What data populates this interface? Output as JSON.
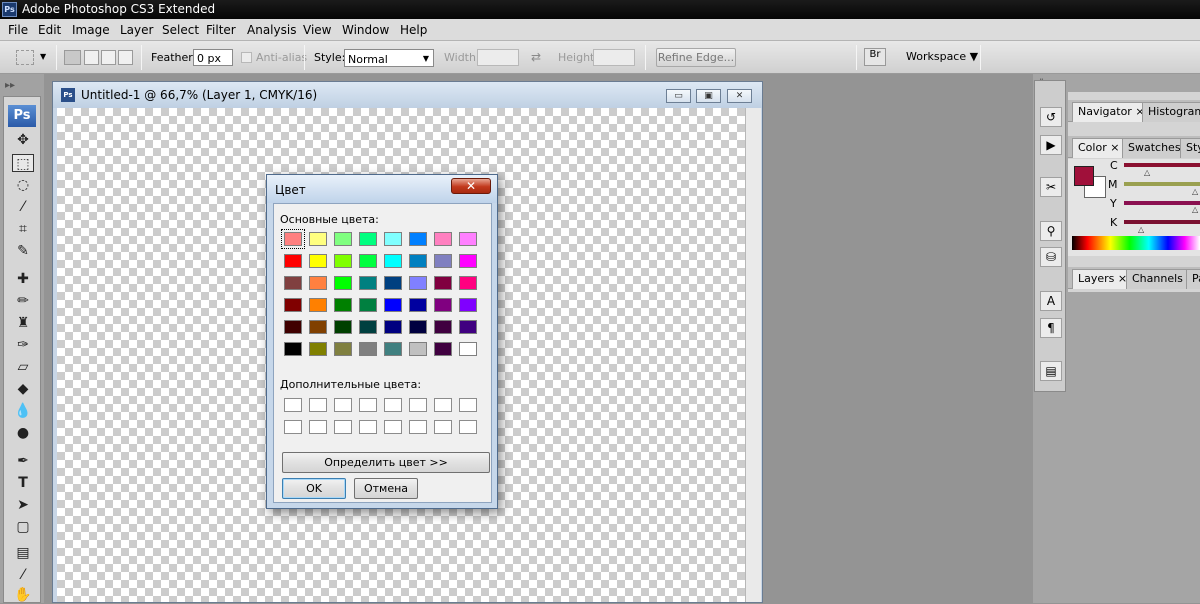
{
  "app": {
    "title": "Adobe Photoshop CS3 Extended",
    "ps_badge": "Ps"
  },
  "menu": [
    "File",
    "Edit",
    "Image",
    "Layer",
    "Select",
    "Filter",
    "Analysis",
    "View",
    "Window",
    "Help"
  ],
  "options": {
    "feather_label": "Feather:",
    "feather_value": "0 px",
    "antialias_label": "Anti-alias",
    "style_label": "Style:",
    "style_value": "Normal",
    "width_label": "Width:",
    "height_label": "Height:",
    "refine_edge": "Refine Edge...",
    "workspace": "Workspace ▼"
  },
  "toolbox": {
    "logo": "Ps"
  },
  "document": {
    "title": "Untitled-1 @ 66,7% (Layer 1, CMYK/16)",
    "icon": "Ps"
  },
  "dialog": {
    "title": "Цвет",
    "basic_label": "Основные цвета:",
    "custom_label": "Дополнительные цвета:",
    "define_button": "Определить цвет >>",
    "ok_button": "OK",
    "cancel_button": "Отмена",
    "close_icon": "✕",
    "basic_colors": [
      [
        "#ff8080",
        "#ffff80",
        "#80ff80",
        "#00ff80",
        "#80ffff",
        "#0080ff",
        "#ff80c0",
        "#ff80ff"
      ],
      [
        "#ff0000",
        "#ffff00",
        "#80ff00",
        "#00ff40",
        "#00ffff",
        "#0080c0",
        "#8080c0",
        "#ff00ff"
      ],
      [
        "#804040",
        "#ff8040",
        "#00ff00",
        "#008080",
        "#004080",
        "#8080ff",
        "#800040",
        "#ff0080"
      ],
      [
        "#800000",
        "#ff8000",
        "#008000",
        "#008040",
        "#0000ff",
        "#0000a0",
        "#800080",
        "#8000ff"
      ],
      [
        "#400000",
        "#804000",
        "#004000",
        "#004040",
        "#000080",
        "#000040",
        "#400040",
        "#400080"
      ],
      [
        "#000000",
        "#808000",
        "#808040",
        "#808080",
        "#408080",
        "#c0c0c0",
        "#400040",
        "#ffffff"
      ]
    ],
    "selected_color": "#ff8080"
  },
  "panels": {
    "tabs_top": [
      "Navigator",
      "Histogram"
    ],
    "tabs_color": [
      "Color",
      "Swatches",
      "Sty"
    ],
    "tabs_layers": [
      "Layers",
      "Channels",
      "Pa"
    ],
    "close_mark": "×",
    "cmyk_labels": [
      "C",
      "M",
      "Y",
      "K"
    ],
    "foreground_color": "#a0103a",
    "cmyk_slider_colors": [
      "#8a1030",
      "#9aa050",
      "#8a1050",
      "#7a1030"
    ]
  }
}
